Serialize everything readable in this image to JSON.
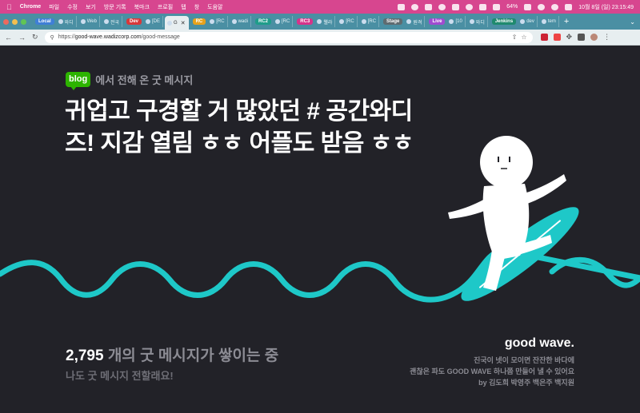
{
  "menubar": {
    "app": "Chrome",
    "items": [
      "파일",
      "수정",
      "보기",
      "방문 기록",
      "북마크",
      "프로필",
      "탭",
      "창",
      "도움말"
    ],
    "battery": "64%",
    "datetime": "10월 8일 (일) 23:15:49"
  },
  "tabs": {
    "groups": [
      {
        "label": "Local",
        "color": "#3f7fd6",
        "tabs": [
          "와디",
          "Web",
          "전국"
        ]
      },
      {
        "label": "Dev",
        "color": "#d9383a",
        "tabs": [
          "[DE"
        ]
      },
      {
        "label": "RC",
        "color": "#e8a21b",
        "tabs": [
          "[RC",
          "wadi"
        ]
      },
      {
        "label": "RC2",
        "color": "#1f9d8a",
        "tabs": [
          "[RC"
        ]
      },
      {
        "label": "RC3",
        "color": "#d6338a",
        "tabs": [
          "웰라",
          "[RC",
          "[RC"
        ]
      },
      {
        "label": "Stage",
        "color": "#5f6b70",
        "tabs": [
          "원격"
        ]
      },
      {
        "label": "Live",
        "color": "#a04bd0",
        "tabs": [
          "[10",
          "와디"
        ]
      },
      {
        "label": "Jenkins",
        "color": "#1f8a6e",
        "tabs": [
          "dev",
          "tem"
        ]
      }
    ],
    "active_tab": "G"
  },
  "toolbar": {
    "url_scheme": "https://",
    "url_host": "good-wave.wadizcorp.com",
    "url_path": "/good-message"
  },
  "page": {
    "blog_badge": "blog",
    "blog_label": "에서 전해 온 굿 메시지",
    "message": "귀업고 구경할 거 많았던 # 공간와디즈! 지감 열림 ㅎㅎ 어플도 받음 ㅎㅎ",
    "count": "2,795",
    "count_text": " 개의 굿 메시지가 쌓이는 중",
    "cta": "나도 굿 메시지 전할래요!",
    "brand": "good wave.",
    "credits": [
      "진국이 넷이 모이면 잔잔한 바다에",
      "괜찮은 파도 GOOD WAVE 하나쯤 만들어 낼 수 있어요",
      "by 김도희 박영주 백은주 백지원"
    ]
  },
  "colors": {
    "background": "#222228",
    "wave": "#1ec8c8",
    "board": "#1ec8c8",
    "menubar": "#d7468f",
    "tabstrip": "#4a8fa3"
  }
}
